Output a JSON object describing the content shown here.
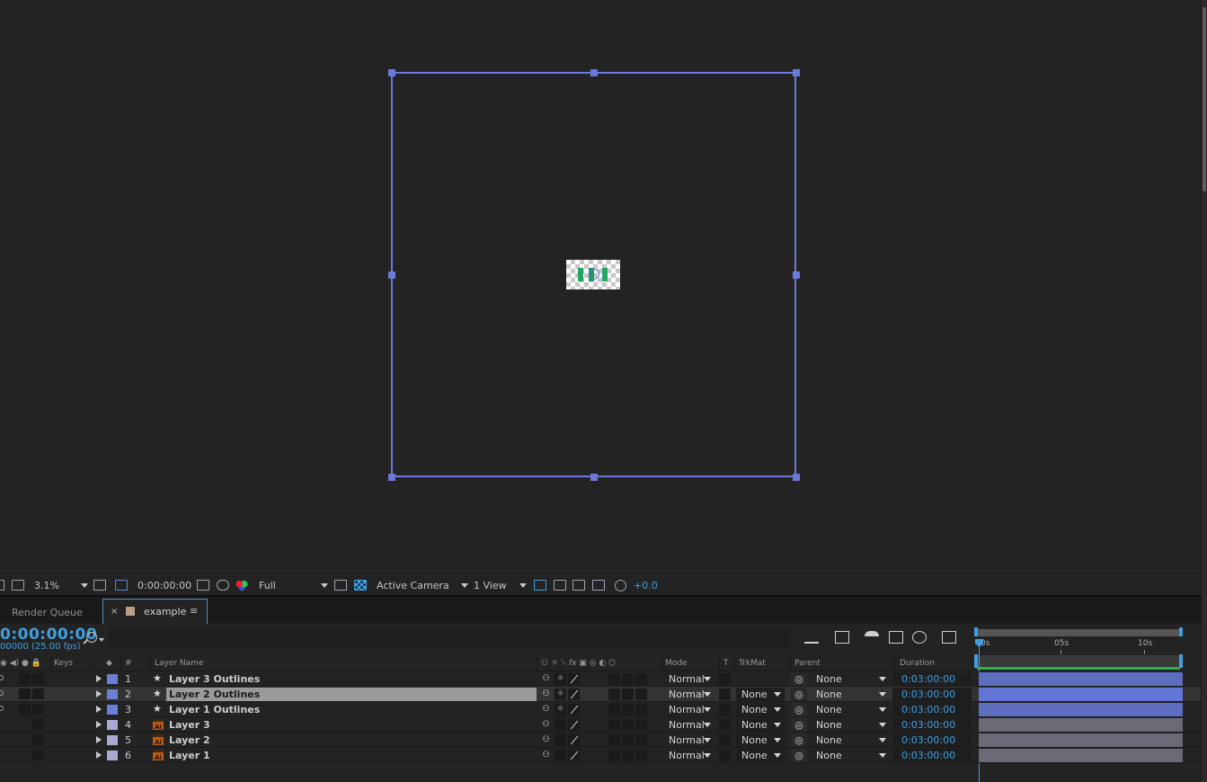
{
  "viewer": {
    "zoom": "3.1%",
    "timecode": "0:00:00:00",
    "resolution": "Full",
    "camera": "Active Camera",
    "views": "1 View",
    "exposure": "+0.0"
  },
  "tabs": {
    "render_queue": "Render Queue",
    "close_glyph": "×",
    "composition": "example",
    "menu_glyph": "≡"
  },
  "timeline": {
    "timecode": "0:00:00:00",
    "frames_fps": "00000 (25.00 fps)",
    "ruler_labels": [
      "0s",
      "05s",
      "10s"
    ]
  },
  "columns": {
    "keys": "Keys",
    "number": "#",
    "layer_name": "Layer Name",
    "mode": "Mode",
    "t": "T",
    "trkmat": "TrkMat",
    "parent": "Parent",
    "duration": "Duration"
  },
  "colors": {
    "accent_blue": "#3f9fe0",
    "selection_frame": "#6a7ad8",
    "shape_label": "#6b7fd7",
    "ai_label": "#a7a8d3",
    "bar_blue": "#5d6ebf",
    "bar_gray": "#6b6b78"
  },
  "layers": [
    {
      "num": "1",
      "name": "Layer 3 Outlines",
      "type": "shape",
      "mode": "Normal",
      "trkmat": "",
      "parent": "None",
      "duration": "0:03:00:00",
      "selected": false
    },
    {
      "num": "2",
      "name": "Layer 2 Outlines",
      "type": "shape",
      "mode": "Normal",
      "trkmat": "None",
      "parent": "None",
      "duration": "0:03:00:00",
      "selected": true
    },
    {
      "num": "3",
      "name": "Layer 1 Outlines",
      "type": "shape",
      "mode": "Normal",
      "trkmat": "None",
      "parent": "None",
      "duration": "0:03:00:00",
      "selected": false
    },
    {
      "num": "4",
      "name": "Layer 3",
      "type": "ai",
      "mode": "Normal",
      "trkmat": "None",
      "parent": "None",
      "duration": "0:03:00:00",
      "selected": false
    },
    {
      "num": "5",
      "name": "Layer 2",
      "type": "ai",
      "mode": "Normal",
      "trkmat": "None",
      "parent": "None",
      "duration": "0:03:00:00",
      "selected": false
    },
    {
      "num": "6",
      "name": "Layer 1",
      "type": "ai",
      "mode": "Normal",
      "trkmat": "None",
      "parent": "None",
      "duration": "0:03:00:00",
      "selected": false
    }
  ],
  "icons": {
    "star_glyph": "★",
    "ai_glyph": "Ai",
    "shy_glyph": "⚇",
    "sun_glyph": "☼",
    "pickwhip_glyph": "◎",
    "fx_label": "fx"
  }
}
